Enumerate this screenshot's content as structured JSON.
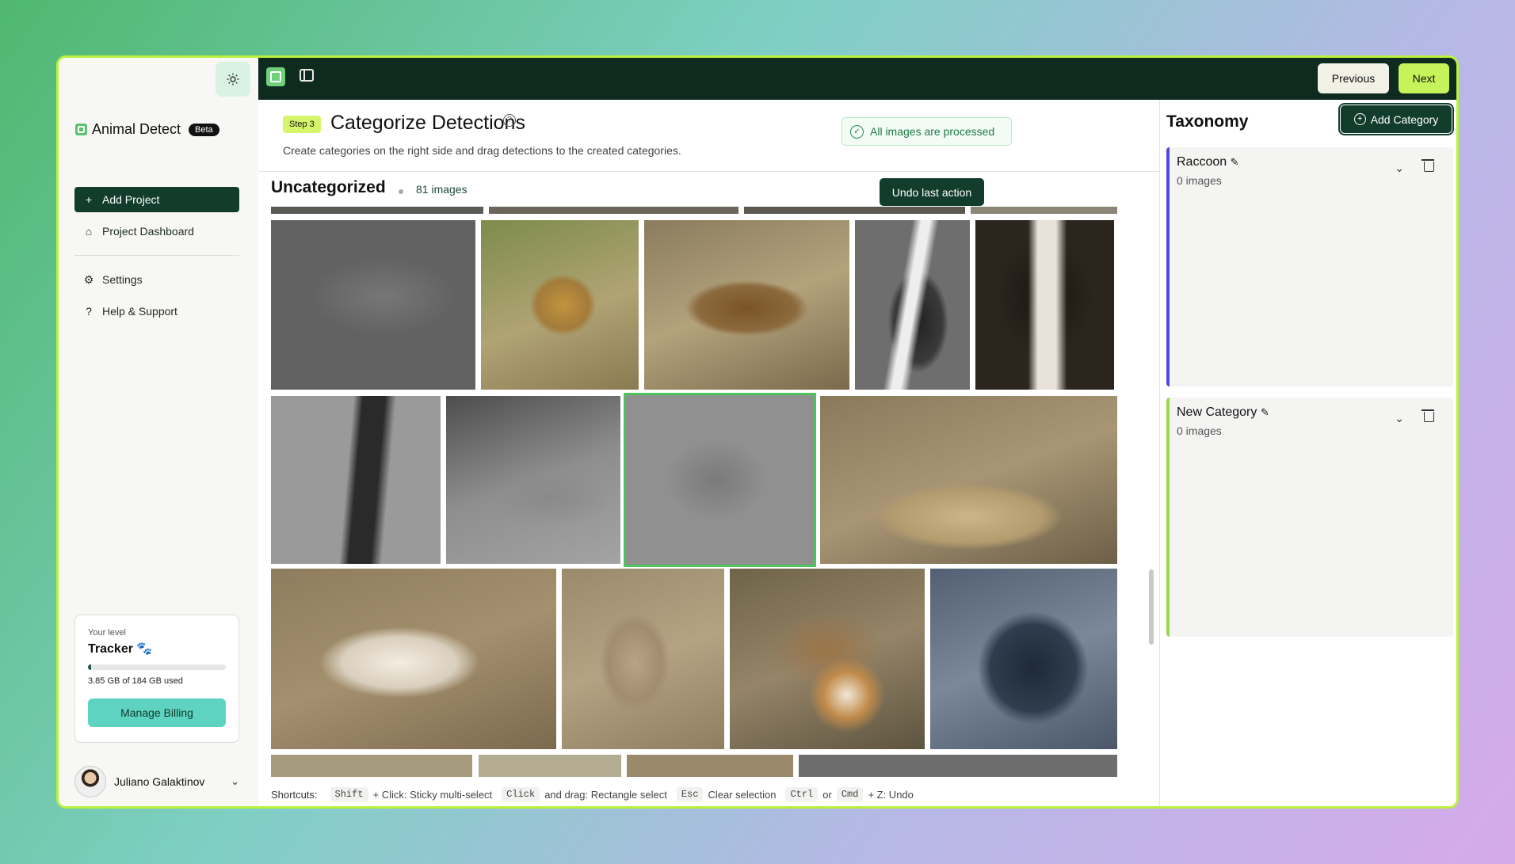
{
  "sidebar": {
    "brand": "Animal Detect",
    "badge": "Beta",
    "nav": {
      "add_project": "Add Project",
      "project_dashboard": "Project Dashboard",
      "settings": "Settings",
      "help": "Help & Support"
    },
    "level": {
      "caption": "Your level",
      "name": "Tracker 🐾",
      "usage": "3.85 GB of 184 GB used",
      "progress": 0.021,
      "billing_button": "Manage Billing"
    },
    "user": {
      "name": "Juliano Galaktinov"
    }
  },
  "topbar": {
    "previous": "Previous",
    "next": "Next"
  },
  "main": {
    "step": "Step 3",
    "title": "Categorize Detections",
    "subtitle": "Create categories on the right side and drag detections to the created categories.",
    "status": "All images are processed",
    "section_title": "Uncategorized",
    "count": "81 images",
    "undo": "Undo last action",
    "shortcuts": {
      "label": "Shortcuts:",
      "k1": "Shift",
      "d1": "+ Click: Sticky multi-select",
      "k2": "Click",
      "d2": "and drag: Rectangle select",
      "k3": "Esc",
      "d3": "Clear selection",
      "k4": "Ctrl",
      "or": "or",
      "k5": "Cmd",
      "d4": "+ Z: Undo"
    }
  },
  "taxonomy": {
    "title": "Taxonomy",
    "add_button": "Add Category",
    "categories": [
      {
        "name": "Raccoon",
        "count": "0 images",
        "color": "#5046e5"
      },
      {
        "name": "New Category",
        "count": "0 images",
        "color": "#9bd94a"
      }
    ]
  },
  "colors": {
    "accent": "#c6f25a",
    "dark": "#0f2a1f",
    "primary": "#123d2d"
  }
}
